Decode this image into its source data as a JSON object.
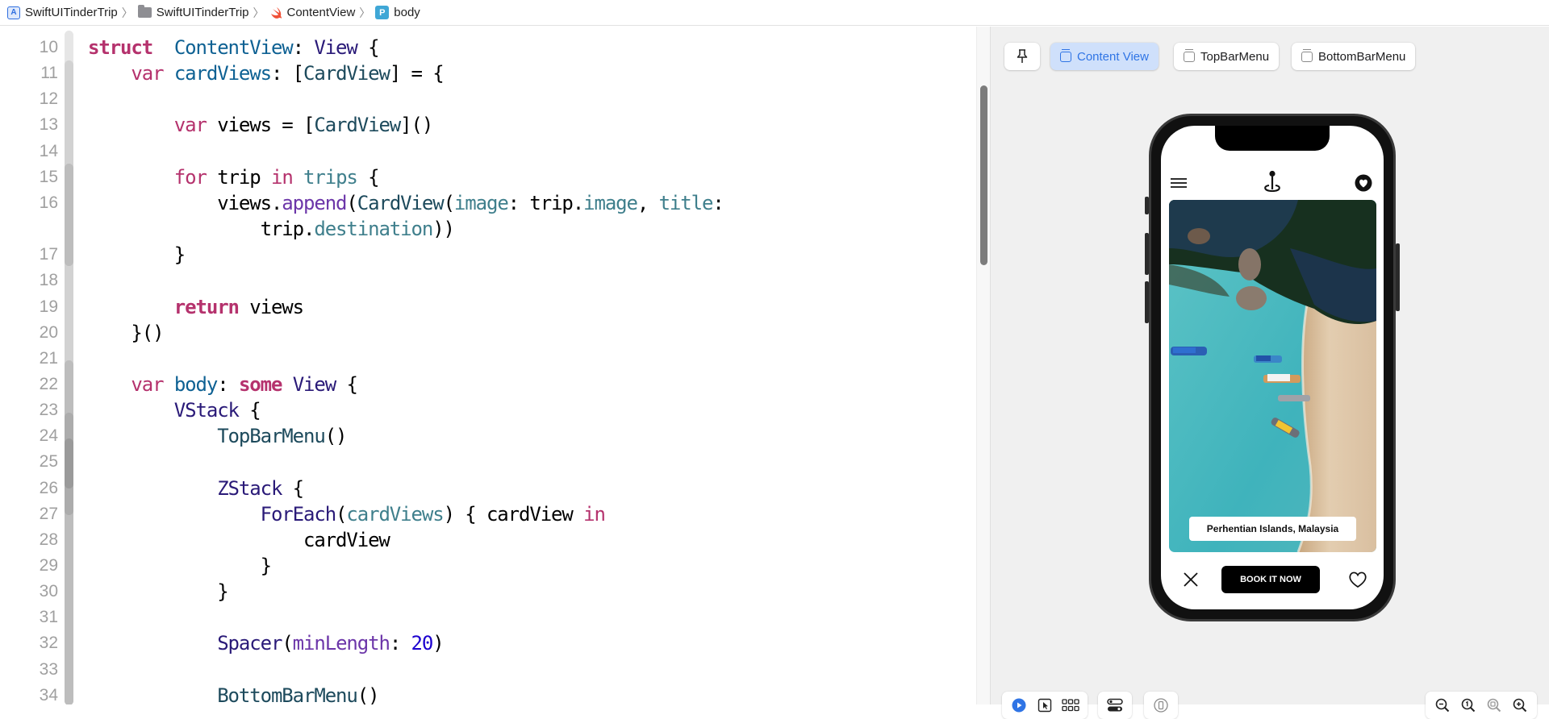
{
  "breadcrumb": [
    {
      "label": "SwiftUITinderTrip",
      "icon": "app-project-icon"
    },
    {
      "label": "SwiftUITinderTrip",
      "icon": "folder-icon"
    },
    {
      "label": "ContentView",
      "icon": "swift-file-icon"
    },
    {
      "label": "body",
      "icon": "property-icon",
      "icon_letter": "P"
    }
  ],
  "editor": {
    "lines": [
      {
        "n": "10",
        "tokens": [
          [
            "kw",
            "struct"
          ],
          [
            "",
            "  "
          ],
          [
            "usr",
            "ContentView"
          ],
          [
            "",
            ": "
          ],
          [
            "typ",
            "View"
          ],
          [
            "",
            " {"
          ]
        ]
      },
      {
        "n": "11",
        "tokens": [
          [
            "",
            "    "
          ],
          [
            "kwn",
            "var"
          ],
          [
            "",
            " "
          ],
          [
            "usr",
            "cardViews"
          ],
          [
            "",
            ": ["
          ],
          [
            "cls",
            "CardView"
          ],
          [
            "",
            "] = {"
          ]
        ]
      },
      {
        "n": "12",
        "tokens": []
      },
      {
        "n": "13",
        "tokens": [
          [
            "",
            "        "
          ],
          [
            "kwn",
            "var"
          ],
          [
            "",
            " views = ["
          ],
          [
            "cls",
            "CardView"
          ],
          [
            "",
            "]()"
          ]
        ]
      },
      {
        "n": "14",
        "tokens": []
      },
      {
        "n": "15",
        "tokens": [
          [
            "",
            "        "
          ],
          [
            "kwn",
            "for"
          ],
          [
            "",
            " trip "
          ],
          [
            "kwn",
            "in"
          ],
          [
            "",
            " "
          ],
          [
            "prop",
            "trips"
          ],
          [
            "",
            " {"
          ]
        ]
      },
      {
        "n": "16",
        "tokens": [
          [
            "",
            "            views."
          ],
          [
            "fn",
            "append"
          ],
          [
            "",
            "("
          ],
          [
            "cls",
            "CardView"
          ],
          [
            "",
            "("
          ],
          [
            "prop",
            "image"
          ],
          [
            "",
            ": trip."
          ],
          [
            "prop",
            "image"
          ],
          [
            "",
            ", "
          ],
          [
            "prop",
            "title"
          ],
          [
            "",
            ":"
          ]
        ]
      },
      {
        "n": "",
        "tokens": [
          [
            "",
            "                trip."
          ],
          [
            "prop",
            "destination"
          ],
          [
            "",
            "))"
          ]
        ]
      },
      {
        "n": "17",
        "tokens": [
          [
            "",
            "        }"
          ]
        ]
      },
      {
        "n": "18",
        "tokens": []
      },
      {
        "n": "19",
        "tokens": [
          [
            "",
            "        "
          ],
          [
            "kw",
            "return"
          ],
          [
            "",
            " views"
          ]
        ]
      },
      {
        "n": "20",
        "tokens": [
          [
            "",
            "    }()"
          ]
        ]
      },
      {
        "n": "21",
        "tokens": []
      },
      {
        "n": "22",
        "tokens": [
          [
            "",
            "    "
          ],
          [
            "kwn",
            "var"
          ],
          [
            "",
            " "
          ],
          [
            "usr",
            "body"
          ],
          [
            "",
            ": "
          ],
          [
            "kw",
            "some"
          ],
          [
            "",
            " "
          ],
          [
            "typ",
            "View"
          ],
          [
            "",
            " {"
          ]
        ]
      },
      {
        "n": "23",
        "tokens": [
          [
            "",
            "        "
          ],
          [
            "typ",
            "VStack"
          ],
          [
            "",
            " {"
          ]
        ]
      },
      {
        "n": "24",
        "tokens": [
          [
            "",
            "            "
          ],
          [
            "cls",
            "TopBarMenu"
          ],
          [
            "",
            "()"
          ]
        ]
      },
      {
        "n": "25",
        "tokens": []
      },
      {
        "n": "26",
        "tokens": [
          [
            "",
            "            "
          ],
          [
            "typ",
            "ZStack"
          ],
          [
            "",
            " {"
          ]
        ]
      },
      {
        "n": "27",
        "tokens": [
          [
            "",
            "                "
          ],
          [
            "typ",
            "ForEach"
          ],
          [
            "",
            "("
          ],
          [
            "prop",
            "cardViews"
          ],
          [
            "",
            ") { cardView "
          ],
          [
            "kwn",
            "in"
          ]
        ]
      },
      {
        "n": "28",
        "tokens": [
          [
            "",
            "                    cardView"
          ]
        ]
      },
      {
        "n": "29",
        "tokens": [
          [
            "",
            "                }"
          ]
        ]
      },
      {
        "n": "30",
        "tokens": [
          [
            "",
            "            }"
          ]
        ]
      },
      {
        "n": "31",
        "tokens": []
      },
      {
        "n": "32",
        "tokens": [
          [
            "",
            "            "
          ],
          [
            "typ",
            "Spacer"
          ],
          [
            "",
            "("
          ],
          [
            "fn",
            "minLength"
          ],
          [
            "",
            ": "
          ],
          [
            "num",
            "20"
          ],
          [
            "",
            ")"
          ]
        ]
      },
      {
        "n": "33",
        "tokens": []
      },
      {
        "n": "34",
        "tokens": [
          [
            "",
            "            "
          ],
          [
            "cls",
            "BottomBarMenu"
          ],
          [
            "",
            "()"
          ]
        ]
      }
    ]
  },
  "preview": {
    "pin_button": "pin-icon",
    "tabs": [
      {
        "label": "Content View",
        "active": true
      },
      {
        "label": "TopBarMenu",
        "active": false
      },
      {
        "label": "BottomBarMenu",
        "active": false
      }
    ],
    "app": {
      "card_title": "Perhentian Islands, Malaysia",
      "book_button": "BOOK IT NOW"
    },
    "toolbar_left": [
      "live-preview-icon",
      "selectable-icon",
      "variants-grid-icon"
    ],
    "toolbar_settings": "device-settings-icon",
    "toolbar_device": "device-icon",
    "zoom_controls": [
      "zoom-out-icon",
      "zoom-actual-size-icon",
      "zoom-to-fit-icon",
      "zoom-in-icon"
    ]
  },
  "colors": {
    "accent": "#2f74e5",
    "keyword": "#b5326d",
    "line_number": "#a0a0a0"
  }
}
